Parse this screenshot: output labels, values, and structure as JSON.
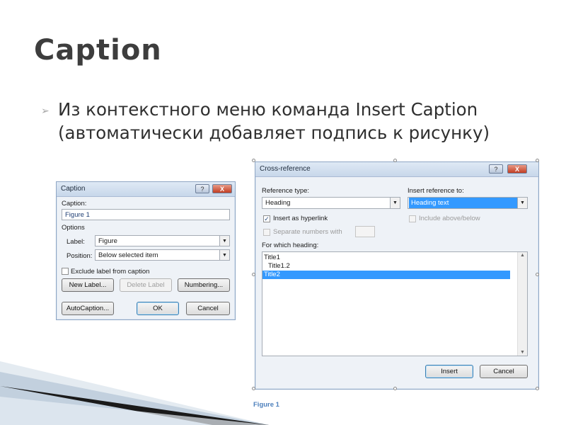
{
  "slide": {
    "title": "Caption",
    "bullet_text": "Из контекстного меню команда Insert Caption (автоматически добавляет подпись к рисунку)"
  },
  "caption_dialog": {
    "title": "Caption",
    "help_button": "?",
    "close_button": "X",
    "caption_label": "Caption:",
    "caption_value": "Figure 1",
    "options_label": "Options",
    "label_label": "Label:",
    "label_value": "Figure",
    "position_label": "Position:",
    "position_value": "Below selected item",
    "exclude_label": "Exclude label from caption",
    "new_label_button": "New Label...",
    "delete_label_button": "Delete Label",
    "numbering_button": "Numbering...",
    "autocaption_button": "AutoCaption...",
    "ok_button": "OK",
    "cancel_button": "Cancel"
  },
  "crossref_dialog": {
    "title": "Cross-reference",
    "help_button": "?",
    "close_button": "X",
    "reference_type_label": "Reference type:",
    "reference_type_value": "Heading",
    "insert_reference_label": "Insert reference to:",
    "insert_reference_value": "Heading text",
    "insert_hyperlink_label": "Insert as hyperlink",
    "include_above_below_label": "Include above/below",
    "separate_numbers_label": "Separate numbers with",
    "for_which_heading_label": "For which heading:",
    "headings": [
      "Title1",
      "Title1.2",
      "Title2"
    ],
    "selected_heading_index": 2,
    "insert_button": "Insert",
    "cancel_button": "Cancel"
  },
  "figure_caption": "Figure 1",
  "colors": {
    "title": "#3d3d3d",
    "selection": "#3399ff",
    "caption_text": "#4f81bd"
  }
}
